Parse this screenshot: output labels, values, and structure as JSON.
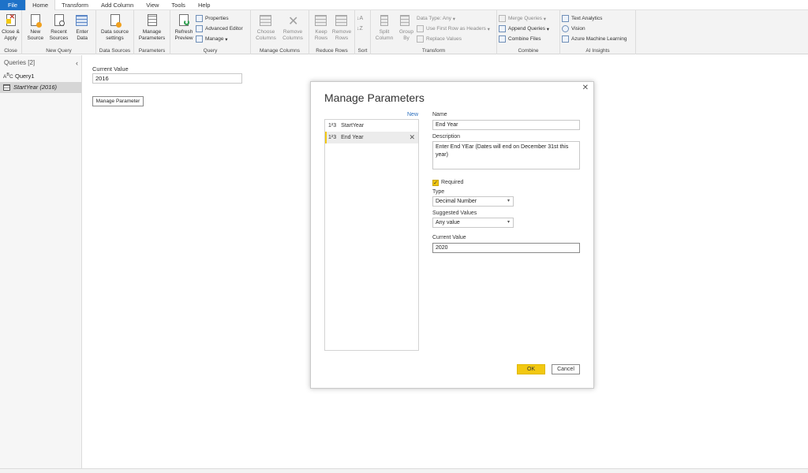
{
  "tabs": [
    "File",
    "Home",
    "Transform",
    "Add Column",
    "View",
    "Tools",
    "Help"
  ],
  "ribbon": {
    "close": {
      "apply_label": "Close & Apply",
      "group": "Close"
    },
    "new_query": {
      "new_source": "New Source",
      "recent_sources": "Recent Sources",
      "enter_data": "Enter Data",
      "group": "New Query"
    },
    "data_sources": {
      "settings": "Data source settings",
      "group": "Data Sources"
    },
    "parameters": {
      "manage": "Manage Parameters",
      "group": "Parameters"
    },
    "query": {
      "refresh": "Refresh Preview",
      "properties": "Properties",
      "advanced_editor": "Advanced Editor",
      "manage": "Manage",
      "group": "Query"
    },
    "manage_columns": {
      "choose": "Choose Columns",
      "remove": "Remove Columns",
      "group": "Manage Columns"
    },
    "reduce_rows": {
      "keep": "Keep Rows",
      "remove": "Remove Rows",
      "group": "Reduce Rows"
    },
    "sort": {
      "group": "Sort"
    },
    "transform": {
      "split": "Split Column",
      "group_by": "Group By",
      "data_type": "Data Type: Any",
      "first_row": "Use First Row as Headers",
      "replace": "Replace Values",
      "group": "Transform"
    },
    "combine": {
      "merge": "Merge Queries",
      "append": "Append Queries",
      "files": "Combine Files",
      "group": "Combine"
    },
    "ai": {
      "text": "Text Analytics",
      "vision": "Vision",
      "aml": "Azure Machine Learning",
      "group": "AI Insights"
    }
  },
  "queries_pane": {
    "header": "Queries [2]",
    "items": [
      {
        "label": "Query1",
        "icon": "ABC"
      },
      {
        "label": "StartYear (2016)",
        "icon": "table"
      }
    ]
  },
  "main": {
    "current_value_label": "Current Value",
    "current_value": "2016",
    "manage_parameter_button": "Manage Parameter"
  },
  "dialog": {
    "title": "Manage Parameters",
    "new_link": "New",
    "parameters": [
      {
        "icon": "1²3",
        "label": "StartYear"
      },
      {
        "icon": "1²3",
        "label": "End Year"
      }
    ],
    "name_label": "Name",
    "name_value": "End Year",
    "description_label": "Description",
    "description_value": "Enter End YEar (Dates will end on December 31st this year)",
    "required_label": "Required",
    "type_label": "Type",
    "type_value": "Decimal Number",
    "suggested_label": "Suggested Values",
    "suggested_value": "Any value",
    "current_label": "Current Value",
    "current_value": "2020",
    "ok": "OK",
    "cancel": "Cancel"
  },
  "colors": {
    "accent_yellow": "#f2c811",
    "file_blue": "#1e72c8",
    "link_blue": "#2a6ebd"
  }
}
